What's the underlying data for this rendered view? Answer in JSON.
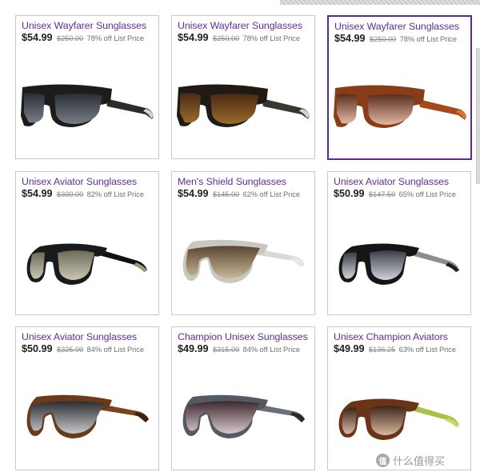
{
  "products": [
    {
      "title": "Unisex Wayfarer Sunglasses",
      "price": "$54.99",
      "was": "$250.00",
      "off": "78% off List Price",
      "frame": "#1c1c1c",
      "lens": "#2a2e33",
      "lens2": "#777e86",
      "arm": "#2c2c2c",
      "tip": "#cfd4d8",
      "shape": "wayfarer",
      "selected": false
    },
    {
      "title": "Unisex Wayfarer Sunglasses",
      "price": "$54.99",
      "was": "$250.00",
      "off": "78% off List Price",
      "frame": "#1f1a16",
      "lens": "#4a2a12",
      "lens2": "#9a6a2e",
      "arm": "#3a3630",
      "tip": "#cfd4d8",
      "shape": "wayfarer",
      "selected": false
    },
    {
      "title": "Unisex Wayfarer Sunglasses",
      "price": "$54.99",
      "was": "$250.00",
      "off": "78% off List Price",
      "frame": "#8a3c18",
      "lens": "#5a2c1c",
      "lens2": "#e2b8a4",
      "arm": "#a54a1a",
      "tip": "#d9733a",
      "shape": "wayfarer",
      "selected": true
    },
    {
      "title": "Unisex Aviator Sunglasses",
      "price": "$54.99",
      "was": "$300.00",
      "off": "82% off List Price",
      "frame": "#1a1a1a",
      "lens": "#6d6a58",
      "lens2": "#c9c7b4",
      "arm": "#111111",
      "tip": "#9a9a7a",
      "shape": "aviator",
      "selected": false
    },
    {
      "title": "Men's Shield Sunglasses",
      "price": "$54.99",
      "was": "$145.00",
      "off": "62% off List Price",
      "frame": "#c8c8c0",
      "lens": "#5a4630",
      "lens2": "#c8b89a",
      "arm": "#d8d8d2",
      "tip": "#e8e8e4",
      "shape": "shield",
      "selected": false
    },
    {
      "title": "Unisex Aviator Sunglasses",
      "price": "$50.99",
      "was": "$147.50",
      "off": "65% off List Price",
      "frame": "#151515",
      "lens": "#3a3d45",
      "lens2": "#cfd3da",
      "arm": "#8a8e94",
      "tip": "#1e1e1e",
      "shape": "aviator2",
      "selected": false
    },
    {
      "title": "Unisex Aviator Sunglasses",
      "price": "$50.99",
      "was": "$325.00",
      "off": "84% off List Price",
      "frame": "#6b3a1a",
      "lens": "#2c2c30",
      "lens2": "#c6c8cc",
      "arm": "#7a4420",
      "tip": "#3a2010",
      "shape": "shield2",
      "selected": false
    },
    {
      "title": "Champion Unisex Sunglasses",
      "price": "$49.99",
      "was": "$315.00",
      "off": "84% off List Price",
      "frame": "#555a62",
      "lens": "#3c2830",
      "lens2": "#d8c8cc",
      "arm": "#6a707a",
      "tip": "#2a2a2a",
      "shape": "shield3",
      "selected": false
    },
    {
      "title": "Unisex Champion Aviators",
      "price": "$49.99",
      "was": "$136.25",
      "off": "63% off List Price",
      "frame": "#6b3418",
      "lens": "#3a2418",
      "lens2": "#d8b8a0",
      "arm": "#a8c24a",
      "tip": "#c8d86a",
      "shape": "aviator3",
      "selected": false
    }
  ],
  "watermark": {
    "badge": "值",
    "text": "什么值得买"
  },
  "colors": {
    "title": "#5d2f9a",
    "selected_border": "#5a2a96"
  }
}
